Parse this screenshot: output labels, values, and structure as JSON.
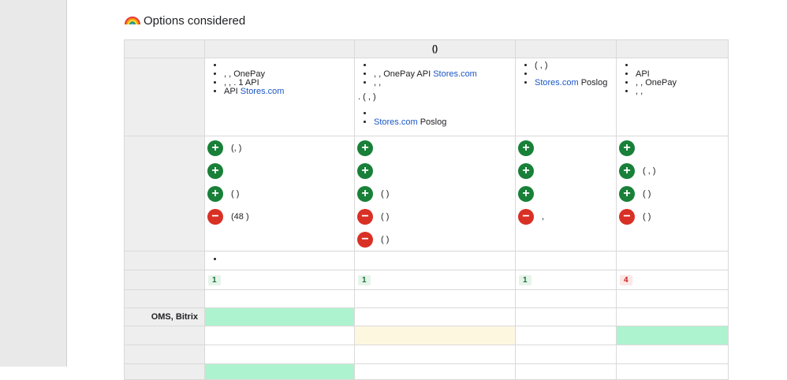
{
  "section": {
    "title": "Options considered",
    "icon": "rainbow-icon"
  },
  "table": {
    "header": [
      "",
      "",
      "()",
      "",
      ""
    ],
    "descriptions": {
      "col1": [
        {
          "parts": [
            ""
          ]
        },
        {
          "parts": [
            ",   ,   OnePay"
          ]
        },
        {
          "parts": [
            ",    ,            . 1    API"
          ]
        },
        {
          "parts": [
            "API    "
          ],
          "link": "Stores.com"
        }
      ],
      "col2_list1": [
        {
          "parts": [
            ""
          ]
        },
        {
          "parts": [
            ",   ,   OnePay       API    "
          ],
          "link": "Stores.com"
        },
        {
          "parts": [
            ",   ,"
          ]
        }
      ],
      "col2_para": ".   ( ,   )",
      "col2_list2": [
        {
          "parts": [
            ""
          ]
        },
        {
          "parts": [
            ""
          ],
          "link": "Stores.com",
          "after": "  Poslog"
        }
      ],
      "col3": [
        {
          "parts": [
            "    ( ,   )"
          ]
        },
        {
          "parts": [
            ""
          ]
        },
        {
          "parts": [
            ""
          ],
          "link": "Stores.com",
          "after": "  Poslog"
        }
      ],
      "col4": [
        {
          "parts": [
            ""
          ]
        },
        {
          "parts": [
            "API"
          ]
        },
        {
          "parts": [
            ",   ,   OnePay"
          ]
        },
        {
          "parts": [
            ",   ,"
          ]
        }
      ]
    },
    "pros_cons": {
      "col1": [
        {
          "type": "plus",
          "text": "(, )"
        },
        {
          "type": "plus",
          "text": ""
        },
        {
          "type": "plus",
          "text": "   (       )"
        },
        {
          "type": "minus",
          "text": "(48 )"
        }
      ],
      "col2": [
        {
          "type": "plus",
          "text": ""
        },
        {
          "type": "plus",
          "text": ""
        },
        {
          "type": "plus",
          "text": "   (       )"
        },
        {
          "type": "minus",
          "text": "(   )"
        },
        {
          "type": "minus",
          "text": "(   )"
        }
      ],
      "col3": [
        {
          "type": "plus",
          "text": ""
        },
        {
          "type": "plus",
          "text": ""
        },
        {
          "type": "plus",
          "text": ""
        },
        {
          "type": "minus",
          "text": ","
        }
      ],
      "col4": [
        {
          "type": "plus",
          "text": ""
        },
        {
          "type": "plus",
          "text": "   (   ,   )"
        },
        {
          "type": "plus",
          "text": "   (       )"
        },
        {
          "type": "minus",
          "text": "   ( )"
        }
      ]
    },
    "scores": [
      "1",
      "1",
      "1",
      "4"
    ],
    "rows_labels": {
      "oms": "OMS, Bitrix"
    }
  }
}
